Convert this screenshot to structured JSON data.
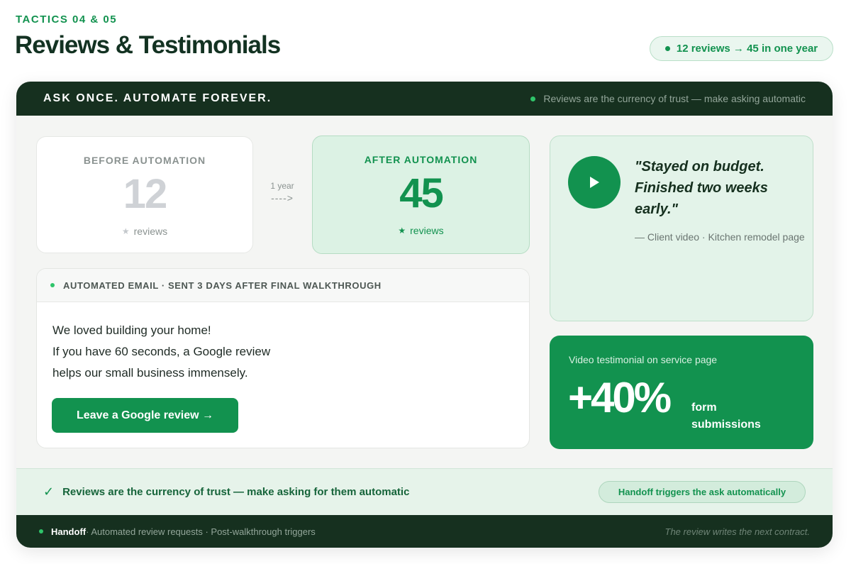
{
  "header": {
    "eyebrow": "TACTICS 04 & 05",
    "title": "Reviews & Testimonials",
    "stat_pill": "12 reviews → 45 in one year"
  },
  "card": {
    "headline": "ASK ONCE. AUTOMATE FOREVER.",
    "subline": "Reviews are the currency of trust — make asking automatic"
  },
  "before": {
    "label": "BEFORE AUTOMATION",
    "value": "12",
    "unit": "reviews",
    "icon": "star-icon"
  },
  "transition": {
    "label": "1 year",
    "arrow": "---->"
  },
  "after": {
    "label": "AFTER AUTOMATION",
    "value": "45",
    "unit": "reviews",
    "icon": "star-icon"
  },
  "email": {
    "header": "AUTOMATED EMAIL · SENT 3 DAYS AFTER FINAL WALKTHROUGH",
    "lines": [
      "We loved building your home!",
      "If you have 60 seconds, a Google review",
      "helps our small business immensely."
    ],
    "cta_label": "Leave a Google review →"
  },
  "video": {
    "quote_lines": [
      "\"Stayed on budget.",
      "Finished two weeks",
      "early.\""
    ],
    "attribution": "— Client video · Kitchen remodel page",
    "icon": "play-icon"
  },
  "lift": {
    "caption": "Video testimonial on service page",
    "value": "+40%",
    "tail_line1": "form",
    "tail_line2": "submissions"
  },
  "strip": {
    "message": "Reviews are the currency of trust — make asking for them automatic",
    "tag": "Handoff triggers the ask automatically",
    "icon": "check-icon"
  },
  "footer": {
    "brand": "Handoff",
    "details": " · Automated review requests · Post-walkthrough triggers",
    "tagline": "The review writes the next contract."
  },
  "colors": {
    "brand_green": "#12924f",
    "dark_green": "#16301f",
    "soft_green": "#dcf2e4"
  }
}
